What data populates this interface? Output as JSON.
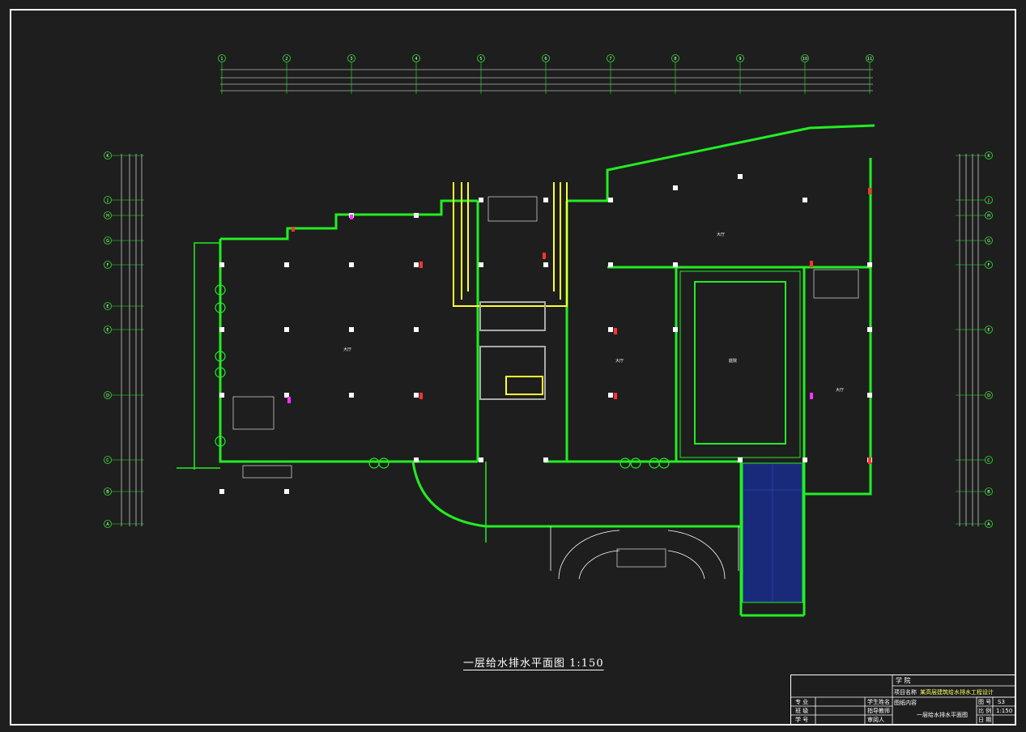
{
  "drawing": {
    "title": "一层给水排水平面图 1:150",
    "room_labels": {
      "main_hall": "大厅",
      "right_hall": "大厅",
      "courtyard": "庭院",
      "right_room": "大厅",
      "north_strip": "大厅"
    }
  },
  "column_axes": [
    "1",
    "2",
    "3",
    "4",
    "5",
    "6",
    "7",
    "8",
    "9",
    "10",
    "11"
  ],
  "row_axes_left": [
    "K",
    "J",
    "H",
    "G",
    "F",
    "E",
    "E",
    "D",
    "C",
    "B",
    "A"
  ],
  "row_axes_right": [
    "K",
    "J",
    "H",
    "G",
    "F",
    "E",
    "D",
    "C",
    "B",
    "A"
  ],
  "title_block": {
    "school_label": "学 院",
    "project_label": "项目名称",
    "project_value": "某高层建筑给水排水工程设计",
    "content_label": "图纸内容",
    "content_value": "一层给水排水平面图",
    "drawing_no_label": "图 号",
    "drawing_no_value": "S3",
    "scale_label": "比 例",
    "scale_value": "1:150",
    "date_label": "日 期",
    "major_label": "专 业",
    "class_label": "班 级",
    "student_no_label": "学 号",
    "student_name_label": "学生姓名",
    "advisor_label": "指导教师",
    "reviewer_label": "审阅人"
  }
}
